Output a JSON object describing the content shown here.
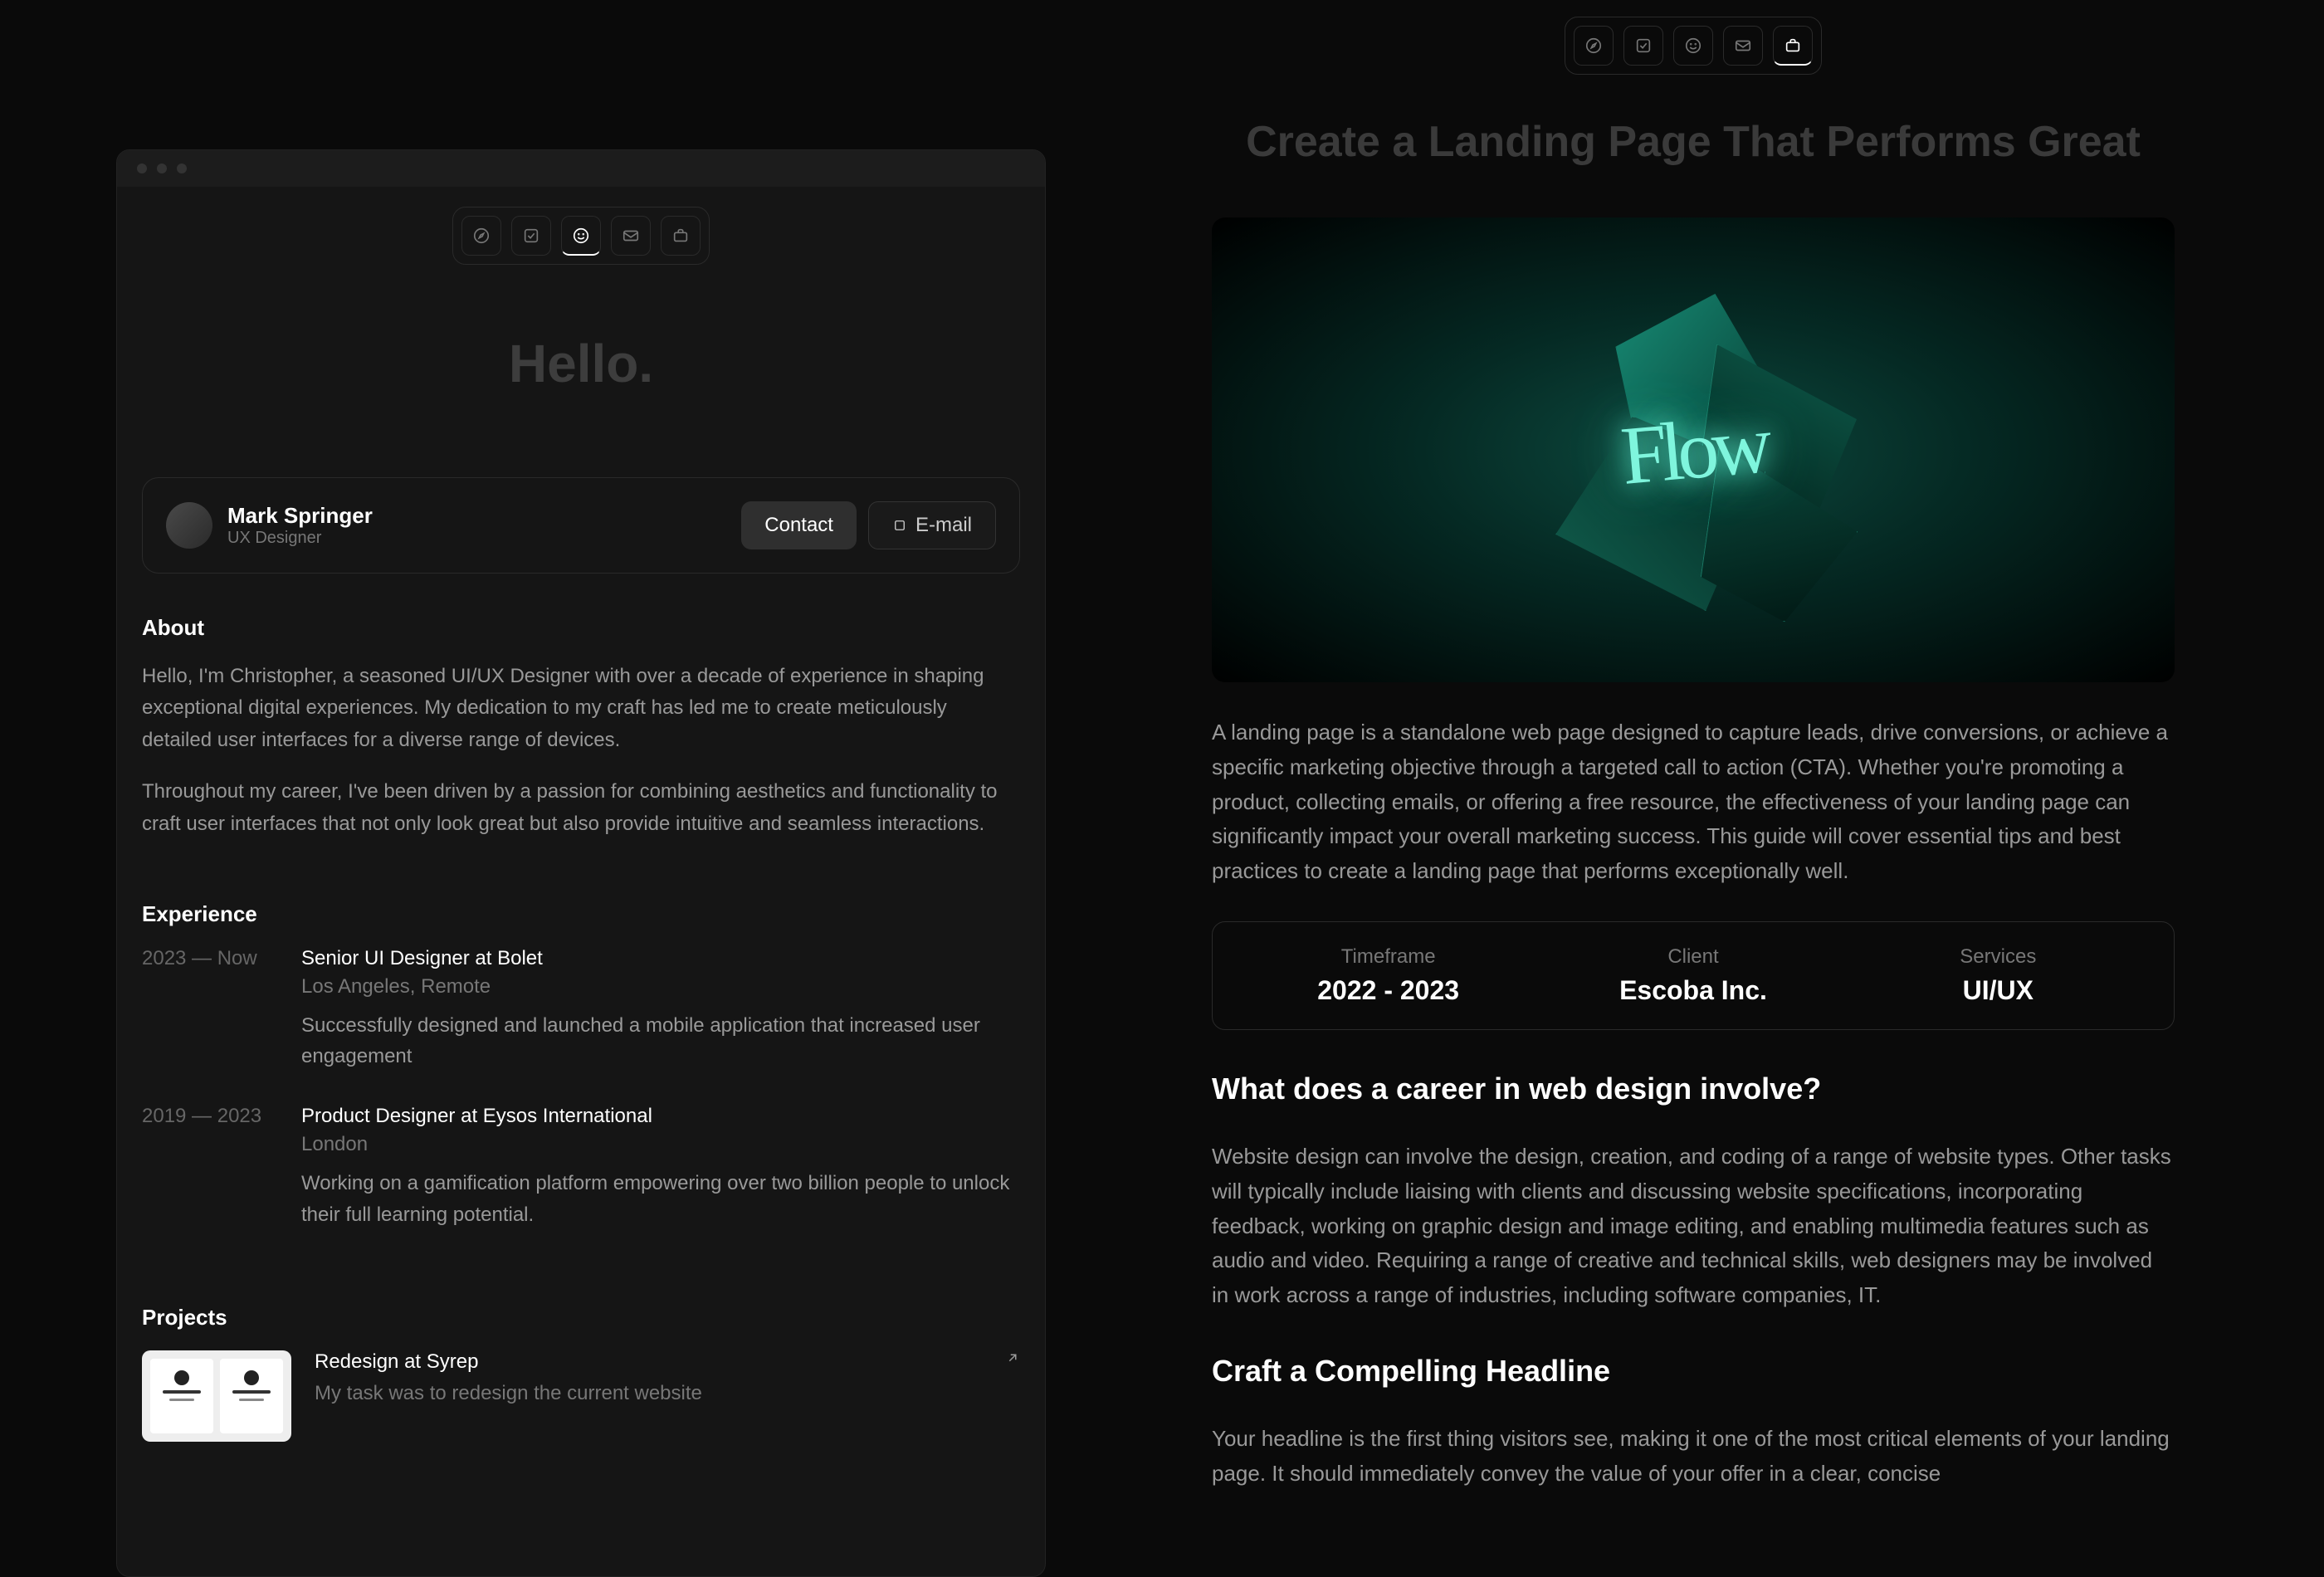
{
  "left": {
    "hello": "Hello.",
    "profile": {
      "name": "Mark Springer",
      "role": "UX Designer",
      "contact_label": "Contact",
      "email_label": "E-mail"
    },
    "about": {
      "title": "About",
      "p1": "Hello, I'm Christopher, a seasoned UI/UX Designer with over a decade of experience in shaping exceptional digital experiences. My dedication to my craft has led me to create meticulously detailed user interfaces for a diverse range of devices.",
      "p2": "Throughout my career, I've been driven by a passion for combining aesthetics and functionality to craft user interfaces that not only look great but also provide intuitive and seamless interactions."
    },
    "experience": {
      "title": "Experience",
      "items": [
        {
          "date": "2023 — Now",
          "title": "Senior UI Designer at Bolet",
          "location": "Los Angeles, Remote",
          "desc": "Successfully designed and launched a mobile application that increased user engagement"
        },
        {
          "date": "2019 — 2023",
          "title": "Product Designer at Eysos International",
          "location": "London",
          "desc": "Working on a gamification platform empowering over two billion people to unlock their full learning potential."
        }
      ]
    },
    "projects": {
      "title": "Projects",
      "items": [
        {
          "title": "Redesign at Syrep",
          "desc": "My task was to redesign the current website"
        }
      ]
    }
  },
  "right": {
    "title": "Create a Landing Page That Performs Great",
    "hero_text": "Flow",
    "intro": "A landing page is a standalone web page designed to capture leads, drive conversions, or achieve a specific marketing objective through a targeted call to action (CTA). Whether you're promoting a product, collecting emails, or offering a free resource, the effectiveness of your landing page can significantly impact your overall marketing success. This guide will cover essential tips and best practices to create a landing page that performs exceptionally well.",
    "meta": {
      "timeframe_label": "Timeframe",
      "timeframe_value": "2022 - 2023",
      "client_label": "Client",
      "client_value": "Escoba Inc.",
      "services_label": "Services",
      "services_value": "UI/UX"
    },
    "section1": {
      "title": "What does a career in web design involve?",
      "body": "Website design can involve the design, creation, and coding of a range of website types. Other tasks will typically include liaising with clients and discussing website specifications, incorporating feedback, working on graphic design and image editing, and enabling multimedia features such as audio and video.  Requiring a range of creative and technical skills, web designers may be involved in work across a range of industries, including software companies, IT."
    },
    "section2": {
      "title": "Craft a Compelling Headline",
      "body": "Your headline is the first thing visitors see, making it one of the most critical elements of your landing page. It should immediately convey the value of your offer in a clear, concise"
    }
  }
}
